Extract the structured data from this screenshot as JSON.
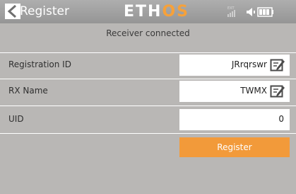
{
  "header": {
    "title": "Register",
    "logo_main": "ETH",
    "logo_accent": "OS",
    "status_ext": "EXT"
  },
  "status": {
    "text": "Receiver connected"
  },
  "form": {
    "fields": [
      {
        "label": "Registration ID",
        "value": "JRrqrswr",
        "editable": true
      },
      {
        "label": "RX Name",
        "value": "TWMX",
        "editable": true
      },
      {
        "label": "UID",
        "value": "0",
        "editable": false
      }
    ],
    "register_label": "Register"
  },
  "colors": {
    "accent": "#f29a3a",
    "background": "#b9b7b5"
  }
}
